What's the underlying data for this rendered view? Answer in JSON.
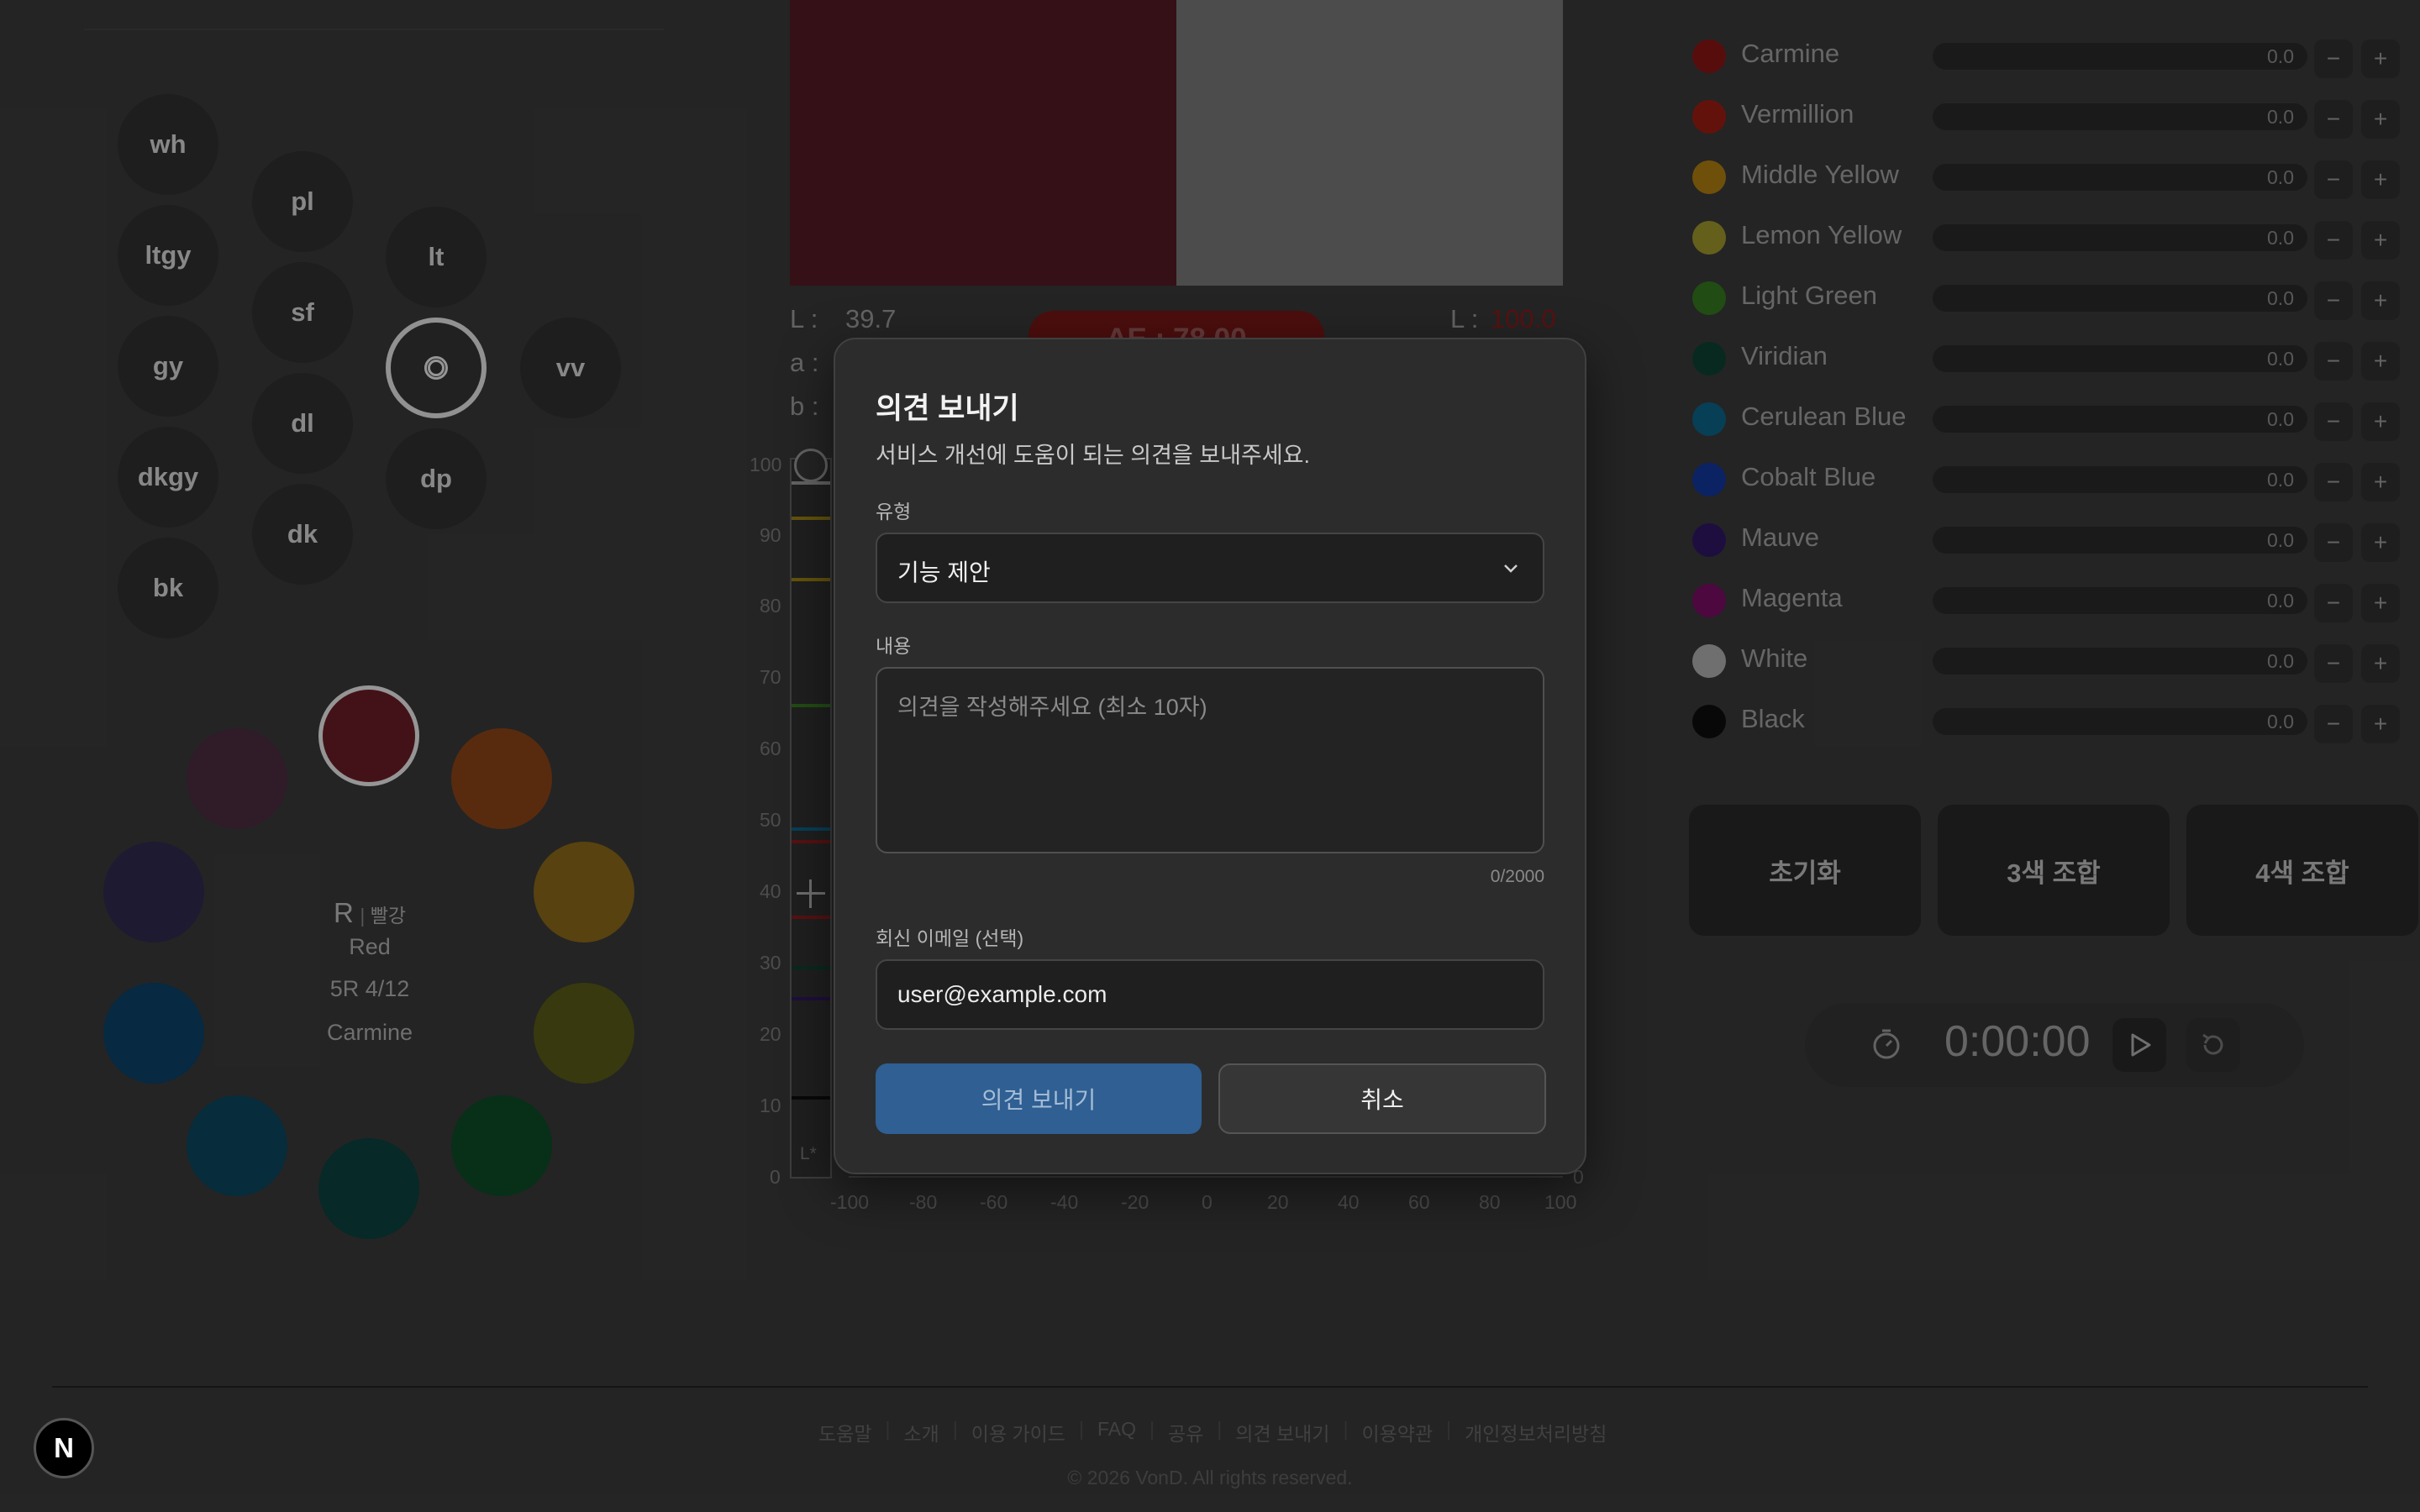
{
  "tones": [
    "wh",
    "ltgy",
    "gy",
    "dkgy",
    "bk",
    "pl",
    "sf",
    "dl",
    "dk",
    "lt",
    "dp",
    "vv"
  ],
  "hue_center": {
    "code": "R",
    "korean": "빨강",
    "english": "Red",
    "munsell": "5R 4/12",
    "pigment": "Carmine"
  },
  "swatch": {
    "left_color": "#4a1820",
    "right_color": "#6a6a6a"
  },
  "lab": {
    "l_label": "L :",
    "l_value": "39.7",
    "a_label": "a :",
    "b_label": "b :",
    "delta_label": "ΔE : 78.00",
    "target_l_label": "L :",
    "target_l_value": "100.0"
  },
  "scale": {
    "y_ticks": [
      "100",
      "90",
      "80",
      "70",
      "60",
      "50",
      "40",
      "30",
      "20",
      "10",
      "0"
    ],
    "x_ticks": [
      "-100",
      "-80",
      "-60",
      "-40",
      "-20",
      "0",
      "20",
      "40",
      "60",
      "80",
      "100"
    ],
    "strip_label": "L*"
  },
  "pigments": [
    {
      "name": "Carmine",
      "color": "#7a1212",
      "value": "0.0"
    },
    {
      "name": "Vermillion",
      "color": "#8a1a10",
      "value": "0.0"
    },
    {
      "name": "Middle Yellow",
      "color": "#9a7010",
      "value": "0.0"
    },
    {
      "name": "Lemon Yellow",
      "color": "#8c8428",
      "value": "0.0"
    },
    {
      "name": "Light Green",
      "color": "#2f6a1c",
      "value": "0.0"
    },
    {
      "name": "Viridian",
      "color": "#0c3a2c",
      "value": "0.0"
    },
    {
      "name": "Cerulean Blue",
      "color": "#0a5878",
      "value": "0.0"
    },
    {
      "name": "Cobalt Blue",
      "color": "#10308a",
      "value": "0.0"
    },
    {
      "name": "Mauve",
      "color": "#2a1458",
      "value": "0.0"
    },
    {
      "name": "Magenta",
      "color": "#6a0c58",
      "value": "0.0"
    },
    {
      "name": "White",
      "color": "#9a9a9a",
      "value": "0.0"
    },
    {
      "name": "Black",
      "color": "#0c0c0c",
      "value": "0.0"
    }
  ],
  "pigment_controls": {
    "minus": "−",
    "plus": "+"
  },
  "actions": {
    "reset": "초기화",
    "mix3": "3색 조합",
    "mix4": "4색 조합"
  },
  "timer": {
    "time": "0:00:00"
  },
  "footer": {
    "links": [
      "도움말",
      "소개",
      "이용 가이드",
      "FAQ",
      "공유",
      "의견 보내기",
      "이용약관",
      "개인정보처리방침"
    ],
    "copyright": "© 2026 VonD. All rights reserved."
  },
  "modal": {
    "title": "의견 보내기",
    "description": "서비스 개선에 도움이 되는 의견을 보내주세요.",
    "type_label": "유형",
    "type_value": "기능 제안",
    "content_label": "내용",
    "content_placeholder": "의견을 작성해주세요 (최소 10자)",
    "char_count": "0/2000",
    "email_label": "회신 이메일 (선택)",
    "email_value": "user@example.com",
    "submit_label": "의견 보내기",
    "cancel_label": "취소"
  },
  "logo_letter": "N"
}
